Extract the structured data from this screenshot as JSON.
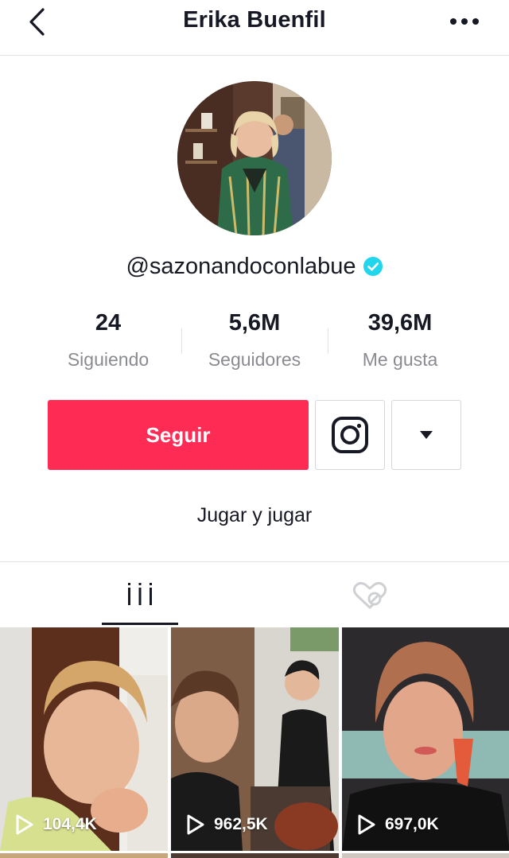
{
  "header": {
    "title": "Erika Buenfil"
  },
  "profile": {
    "handle": "@sazonandoconlabue",
    "verified": true,
    "stats": [
      {
        "value": "24",
        "label": "Siguiendo"
      },
      {
        "value": "5,6M",
        "label": "Seguidores"
      },
      {
        "value": "39,6M",
        "label": "Me gusta"
      }
    ],
    "follow_label": "Seguir",
    "bio": "Jugar y jugar"
  },
  "tabs": [
    {
      "icon": "videos-grid-icon",
      "active": true
    },
    {
      "icon": "liked-hidden-icon",
      "active": false
    }
  ],
  "videos": [
    {
      "views": "104,4K"
    },
    {
      "views": "962,5K"
    },
    {
      "views": "697,0K"
    }
  ],
  "colors": {
    "accent": "#fe2c55",
    "verified": "#20d5ec",
    "text": "#161823",
    "muted": "#8a8b91"
  }
}
